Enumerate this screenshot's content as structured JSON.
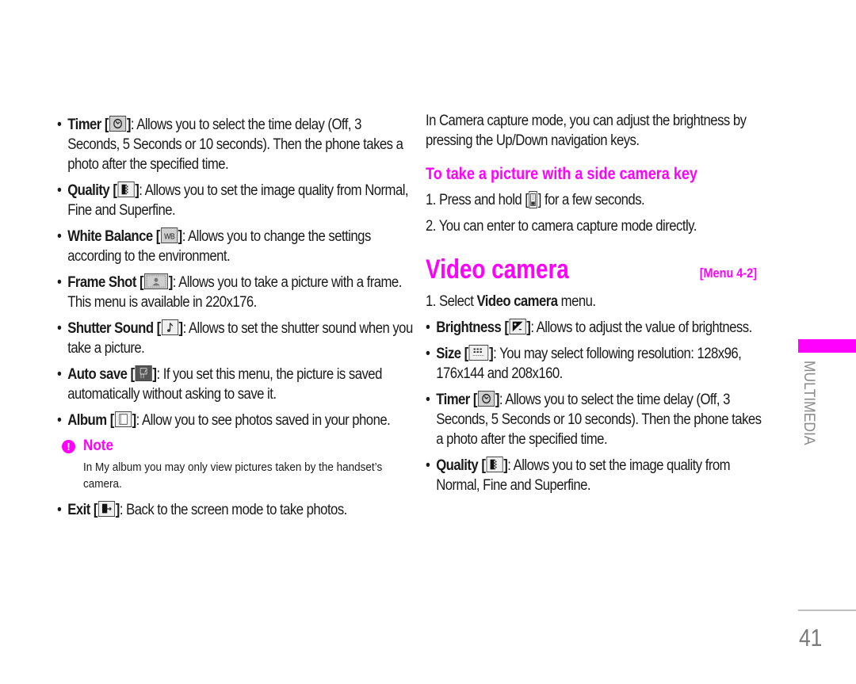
{
  "left_column": {
    "items": [
      {
        "label": "Timer",
        "icon": "timer-icon",
        "desc": ": Allows you to select the time delay (Off, 3 Seconds, 5 Seconds or 10 seconds). Then the phone takes a photo after the specified time."
      },
      {
        "label": "Quality",
        "icon": "quality-icon",
        "desc": ": Allows you to set the image quality from Normal, Fine and Superfine."
      },
      {
        "label": "White Balance",
        "icon": "white-balance-icon",
        "desc": ": Allows you to change the settings according to the environment."
      },
      {
        "label": "Frame Shot",
        "icon": "frame-shot-icon",
        "desc": ": Allows you to take a picture with a frame. This menu is available in 220x176."
      },
      {
        "label": "Shutter Sound",
        "icon": "shutter-sound-icon",
        "desc": ": Allows to set the shutter sound when you take a picture."
      },
      {
        "label": "Auto save",
        "icon": "auto-save-icon",
        "desc": ": If you set this menu, the picture is saved automatically without asking to save it."
      },
      {
        "label": "Album",
        "icon": "album-icon",
        "desc": ": Allow you to see photos saved in your phone."
      }
    ],
    "note": {
      "icon": "exclamation-icon",
      "title": "Note",
      "body": "In My album you may only view pictures taken by the handset’s camera."
    },
    "exit_item": {
      "label": "Exit",
      "icon": "exit-icon",
      "desc": ": Back to the screen mode to take photos."
    },
    "icon_glyphs": {
      "white_balance": "WB"
    }
  },
  "right_column": {
    "intro": "In Camera capture mode, you can adjust the brightness by pressing the Up/Down navigation keys.",
    "side_key_heading": "To take a picture with a side camera key",
    "side_key_steps": [
      {
        "num": "1.",
        "before": "Press and hold [",
        "icon": "side-camera-key-icon",
        "after": "] for a few seconds."
      },
      {
        "num": "2.",
        "text": "You can enter to camera capture mode directly."
      }
    ],
    "section": {
      "title": "Video camera",
      "menu_ref": "[Menu 4-2]"
    },
    "select_step": {
      "num": "1.",
      "before": "Select ",
      "bold": "Video camera",
      "after": " menu."
    },
    "items": [
      {
        "label": "Brightness",
        "icon": "brightness-icon",
        "desc": ": Allows to adjust the value of brightness."
      },
      {
        "label": "Size",
        "icon": "size-icon",
        "desc": ": You may select following resolution: 128x96, 176x144 and 208x160."
      },
      {
        "label": "Timer",
        "icon": "timer-icon",
        "desc": ": Allows you to select the time delay (Off, 3 Seconds, 5 Seconds or 10 seconds). Then the phone takes a photo after the specified time."
      },
      {
        "label": "Quality",
        "icon": "quality-icon",
        "desc": ": Allows you to set the image quality from Normal, Fine and Superfine."
      }
    ]
  },
  "sidebar": {
    "section_label": "MULTIMEDIA",
    "accent_color": "#ff00ff"
  },
  "footer": {
    "page_number": "41"
  },
  "colors": {
    "accent": "#ff00ff",
    "text": "#1a1a1a",
    "muted": "#8a8a8a"
  }
}
